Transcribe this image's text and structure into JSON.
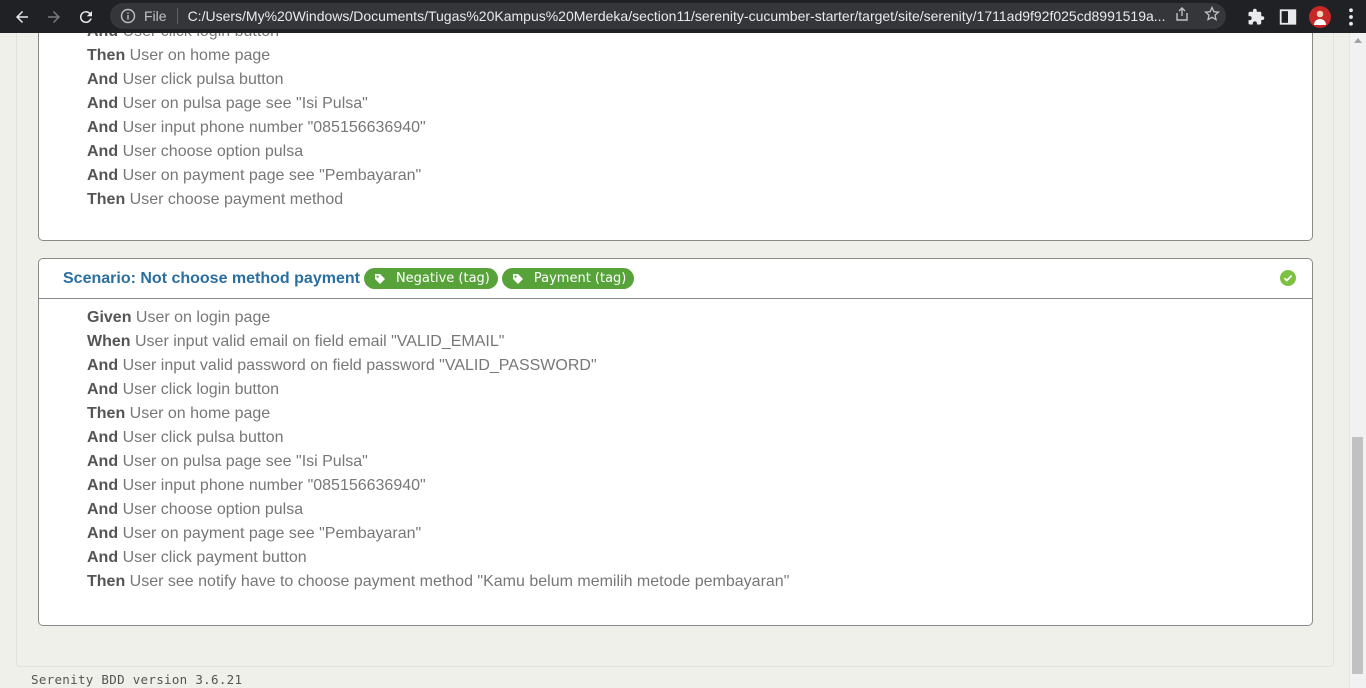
{
  "browser": {
    "file_label": "File",
    "url": "C:/Users/My%20Windows/Documents/Tugas%20Kampus%20Merdeka/section11/serenity-cucumber-starter/target/site/serenity/1711ad9f92f025cd8991519a..."
  },
  "previous_scenario": {
    "steps": [
      {
        "kw": "And",
        "text": "User click login button"
      },
      {
        "kw": "Then",
        "text": "User on home page"
      },
      {
        "kw": "And",
        "text": "User click pulsa button"
      },
      {
        "kw": "And",
        "text": "User on pulsa page see \"Isi Pulsa\""
      },
      {
        "kw": "And",
        "text": "User input phone number \"085156636940\""
      },
      {
        "kw": "And",
        "text": "User choose option pulsa"
      },
      {
        "kw": "And",
        "text": "User on payment page see \"Pembayaran\""
      },
      {
        "kw": "Then",
        "text": "User choose payment method"
      }
    ]
  },
  "scenario": {
    "title": "Scenario: Not choose method payment",
    "tags": [
      "Negative (tag)",
      "Payment (tag)"
    ],
    "status_icon": "check-circle",
    "steps": [
      {
        "kw": "Given",
        "text": "User on login page"
      },
      {
        "kw": "When",
        "text": "User input valid email on field email \"VALID_EMAIL\""
      },
      {
        "kw": "And",
        "text": "User input valid password on field password \"VALID_PASSWORD\""
      },
      {
        "kw": "And",
        "text": "User click login button"
      },
      {
        "kw": "Then",
        "text": "User on home page"
      },
      {
        "kw": "And",
        "text": "User click pulsa button"
      },
      {
        "kw": "And",
        "text": "User on pulsa page see \"Isi Pulsa\""
      },
      {
        "kw": "And",
        "text": "User input phone number \"085156636940\""
      },
      {
        "kw": "And",
        "text": "User choose option pulsa"
      },
      {
        "kw": "And",
        "text": "User on payment page see \"Pembayaran\""
      },
      {
        "kw": "And",
        "text": "User click payment button"
      },
      {
        "kw": "Then",
        "text": "User see notify have to choose payment method \"Kamu belum memilih metode pembayaran\""
      }
    ]
  },
  "footer": {
    "version": "Serenity BDD version 3.6.21"
  },
  "colors": {
    "tag": "#57a33a",
    "title": "#2a6fa0",
    "pass": "#7cc142"
  }
}
